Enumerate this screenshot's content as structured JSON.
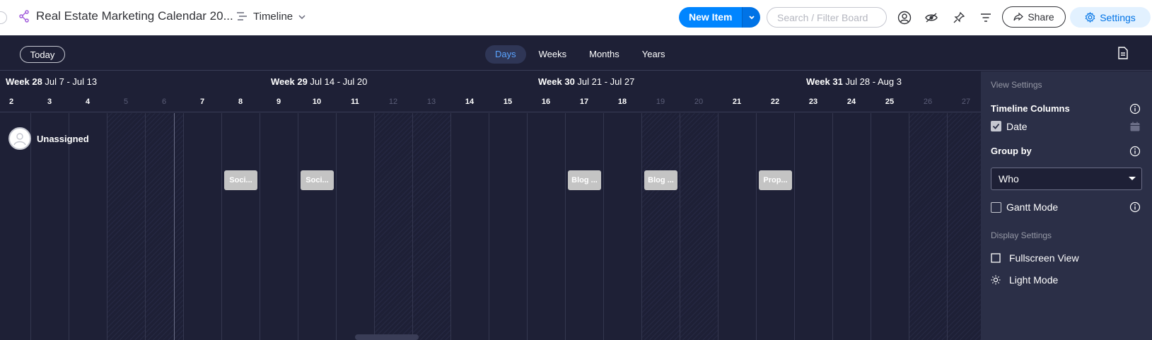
{
  "header": {
    "board_title": "Real Estate Marketing Calendar 20...",
    "view_name": "Timeline",
    "new_item_label": "New Item",
    "search_placeholder": "Search / Filter Board",
    "share_label": "Share",
    "settings_label": "Settings"
  },
  "toolbar": {
    "today_label": "Today",
    "scale_tabs": [
      "Days",
      "Weeks",
      "Months",
      "Years"
    ],
    "active_scale": "Days"
  },
  "timeline": {
    "weeks": [
      {
        "name": "Week 28",
        "range": "Jul 7 - Jul 13"
      },
      {
        "name": "Week 29",
        "range": "Jul 14 - Jul 20"
      },
      {
        "name": "Week 30",
        "range": "Jul 21 - Jul 27"
      },
      {
        "name": "Week 31",
        "range": "Jul 28 - Aug 3"
      }
    ],
    "days": [
      "2",
      "3",
      "4",
      "5",
      "6",
      "7",
      "8",
      "9",
      "10",
      "11",
      "12",
      "13",
      "14",
      "15",
      "16",
      "17",
      "18",
      "19",
      "20",
      "21",
      "22",
      "23",
      "24",
      "25",
      "26",
      "27"
    ],
    "weekend_days": [
      "5",
      "6",
      "12",
      "13",
      "19",
      "20",
      "26",
      "27"
    ],
    "group_name": "Unassigned",
    "items": [
      {
        "label": "Soci...",
        "day": "8"
      },
      {
        "label": "Soci...",
        "day": "10"
      },
      {
        "label": "Blog ...",
        "day": "17"
      },
      {
        "label": "Blog ...",
        "day": "19"
      },
      {
        "label": "Prop...",
        "day": "22"
      }
    ]
  },
  "settings_panel": {
    "view_settings_title": "View Settings",
    "timeline_columns_label": "Timeline Columns",
    "date_column_label": "Date",
    "date_checked": true,
    "group_by_label": "Group by",
    "group_by_value": "Who",
    "gantt_mode_label": "Gantt Mode",
    "gantt_checked": false,
    "display_settings_title": "Display Settings",
    "fullscreen_label": "Fullscreen View",
    "light_mode_label": "Light Mode"
  },
  "colors": {
    "accent": "#0085ff",
    "background": "#1e2036",
    "panel": "#2b2f47",
    "item_bar": "#c4c4c4"
  }
}
